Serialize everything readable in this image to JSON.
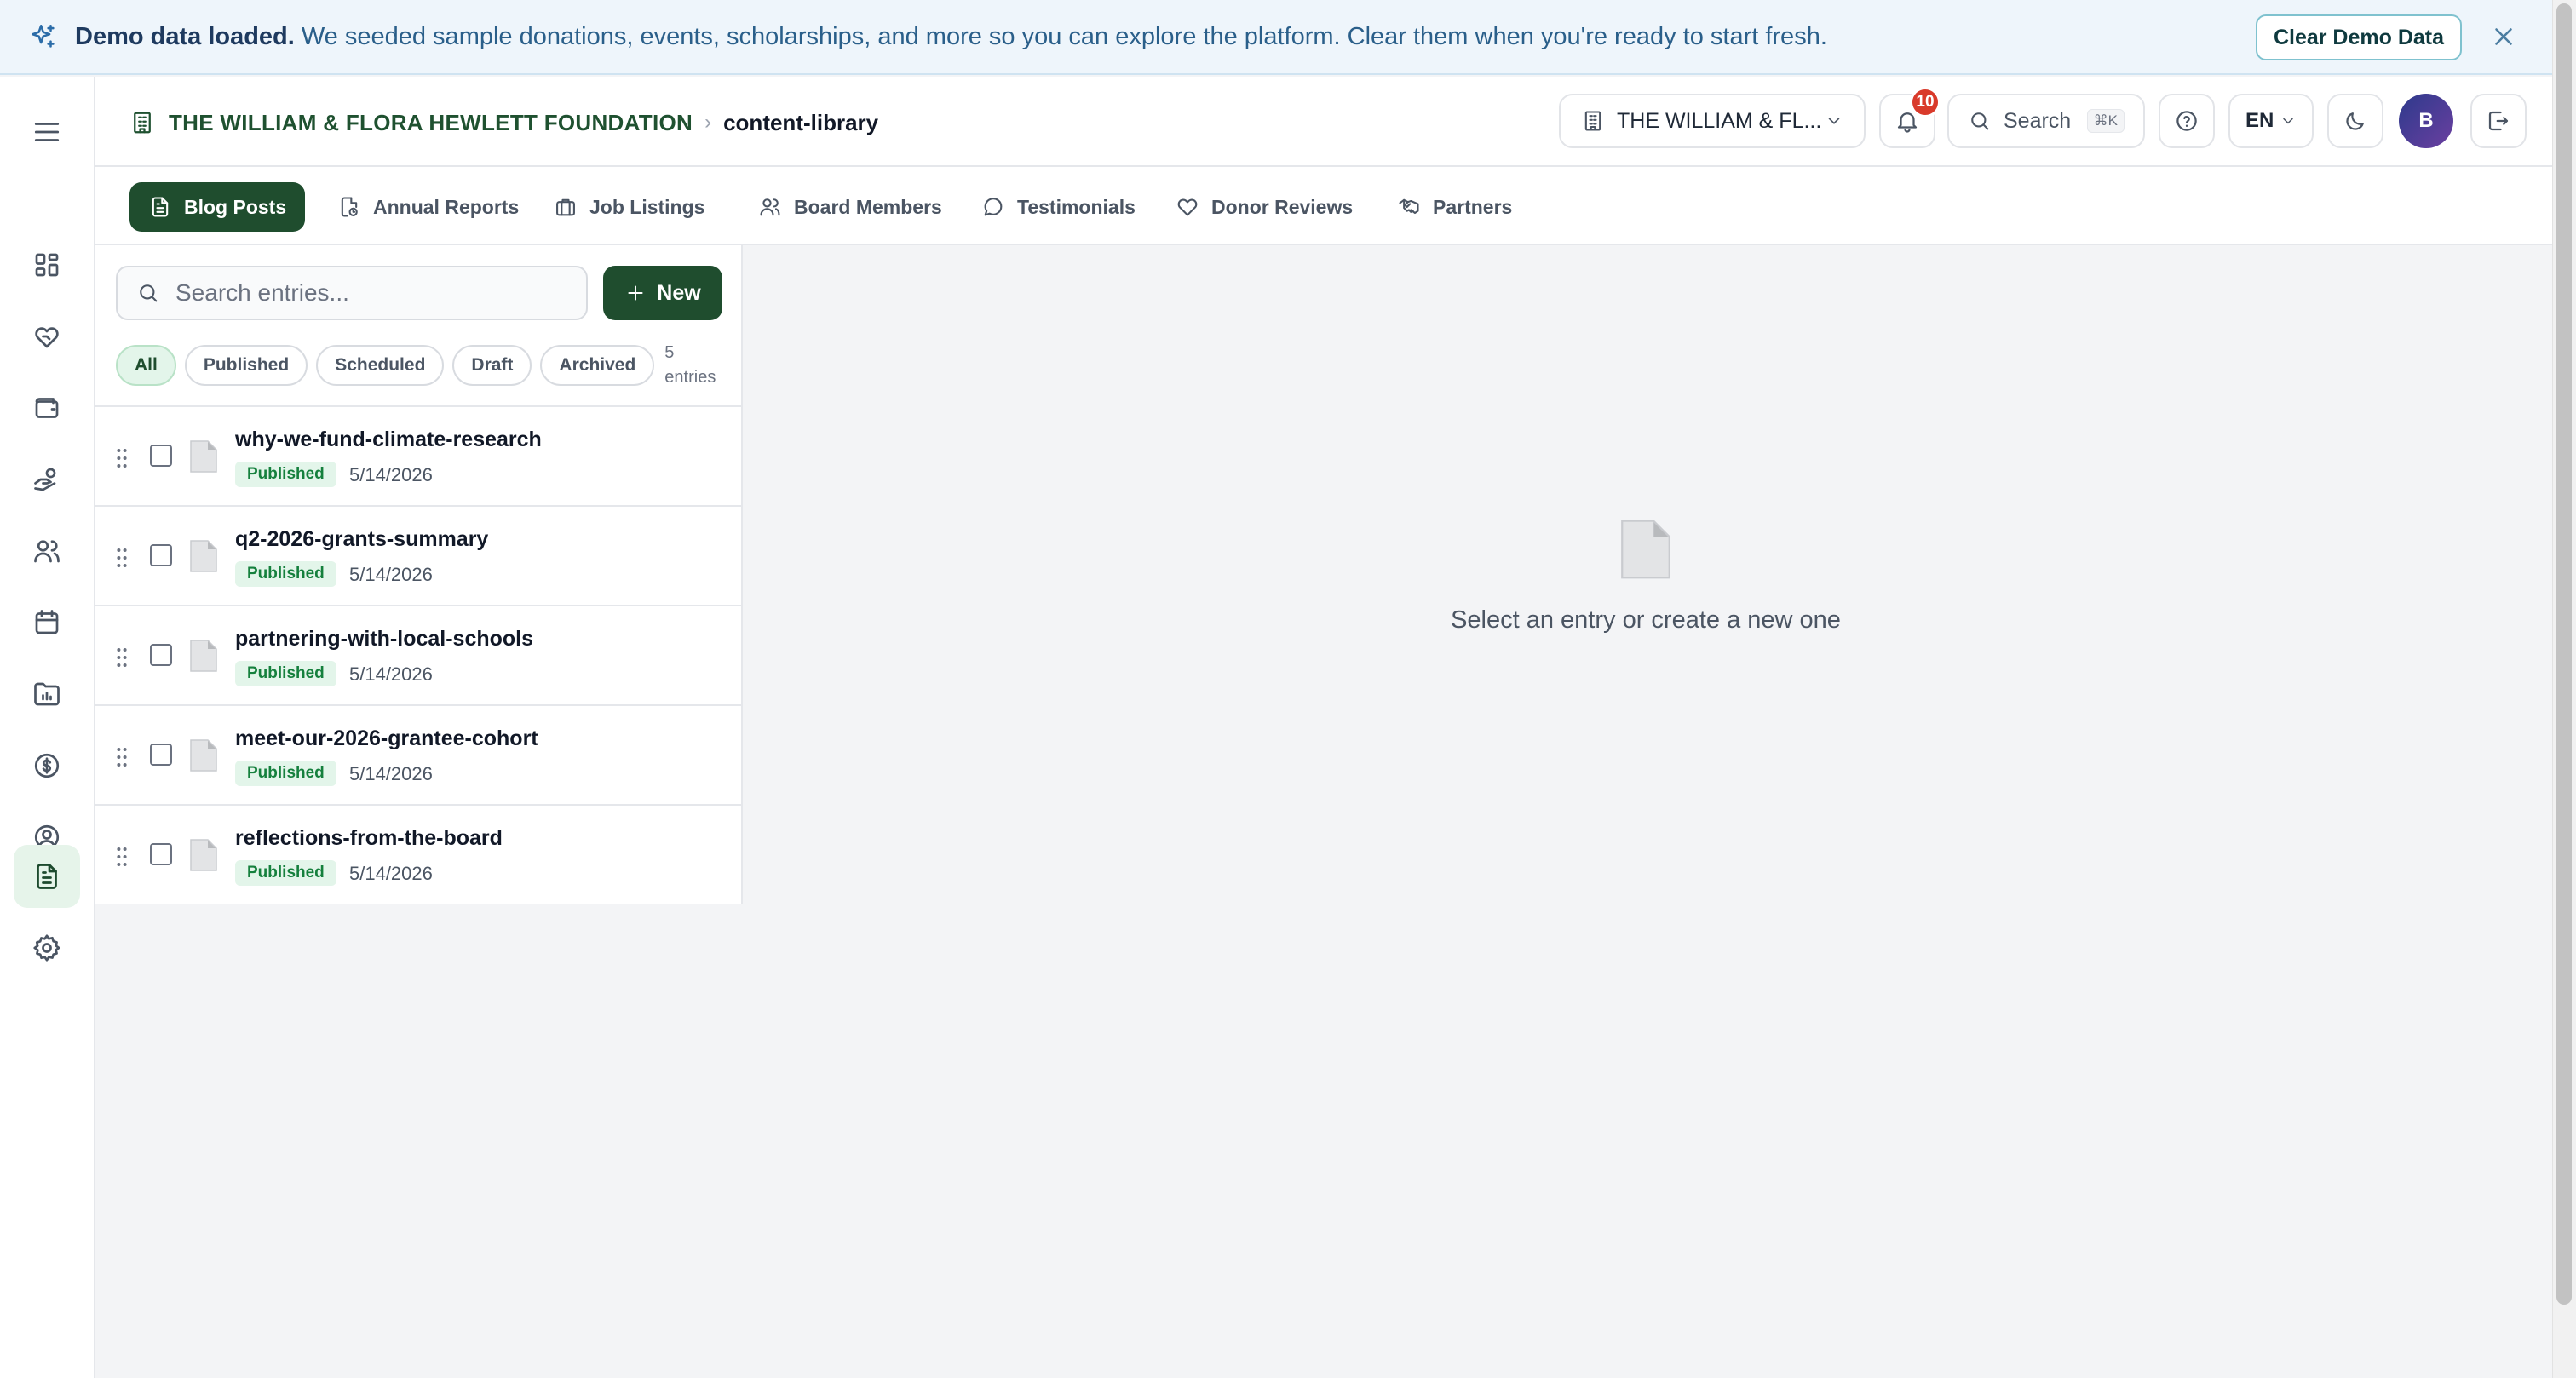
{
  "banner": {
    "title": "Demo data loaded.",
    "message": "We seeded sample donations, events, scholarships, and more so you can explore the platform. Clear them when you're ready to start fresh.",
    "clear_button": "Clear Demo Data"
  },
  "breadcrumb": {
    "org": "THE WILLIAM & FLORA HEWLETT FOUNDATION",
    "separator": "›",
    "page": "content-library"
  },
  "topbar": {
    "org_selector": "THE WILLIAM & FL...",
    "notifications_count": "10",
    "search_label": "Search",
    "search_shortcut": "⌘K",
    "language": "EN",
    "avatar_initial": "B"
  },
  "tabs": [
    {
      "label": "Blog Posts",
      "icon": "file-text-icon",
      "active": true
    },
    {
      "label": "Annual Reports",
      "icon": "report-icon"
    },
    {
      "label": "Job Listings",
      "icon": "briefcase-icon"
    },
    {
      "label": "Board Members",
      "icon": "users-icon"
    },
    {
      "label": "Testimonials",
      "icon": "message-circle-icon"
    },
    {
      "label": "Donor Reviews",
      "icon": "heart-icon"
    },
    {
      "label": "Partners",
      "icon": "handshake-icon"
    }
  ],
  "list": {
    "search_placeholder": "Search entries...",
    "new_button": "New",
    "filters": [
      "All",
      "Published",
      "Scheduled",
      "Draft",
      "Archived"
    ],
    "active_filter": "All",
    "count_number": "5",
    "count_label": "entries",
    "entries": [
      {
        "title": "why-we-fund-climate-research",
        "status": "Published",
        "date": "5/14/2026"
      },
      {
        "title": "q2-2026-grants-summary",
        "status": "Published",
        "date": "5/14/2026"
      },
      {
        "title": "partnering-with-local-schools",
        "status": "Published",
        "date": "5/14/2026"
      },
      {
        "title": "meet-our-2026-grantee-cohort",
        "status": "Published",
        "date": "5/14/2026"
      },
      {
        "title": "reflections-from-the-board",
        "status": "Published",
        "date": "5/14/2026"
      }
    ]
  },
  "empty_state": {
    "message": "Select an entry or create a new one"
  },
  "sidebar": {
    "items": [
      {
        "icon": "dashboard-icon"
      },
      {
        "icon": "heart-hand-icon"
      },
      {
        "icon": "wallet-icon"
      },
      {
        "icon": "hand-coins-icon"
      },
      {
        "icon": "users-icon"
      },
      {
        "icon": "calendar-icon"
      },
      {
        "icon": "chart-folder-icon"
      },
      {
        "icon": "dollar-circle-icon"
      },
      {
        "icon": "user-circle-icon"
      },
      {
        "icon": "document-icon",
        "active": true
      },
      {
        "icon": "settings-icon"
      }
    ]
  },
  "colors": {
    "brand": "#1f4d2e",
    "banner_bg": "#eef5fb",
    "published_badge_bg": "#e3f5ea",
    "published_badge_text": "#15803d",
    "notification_badge": "#d93a2b"
  }
}
